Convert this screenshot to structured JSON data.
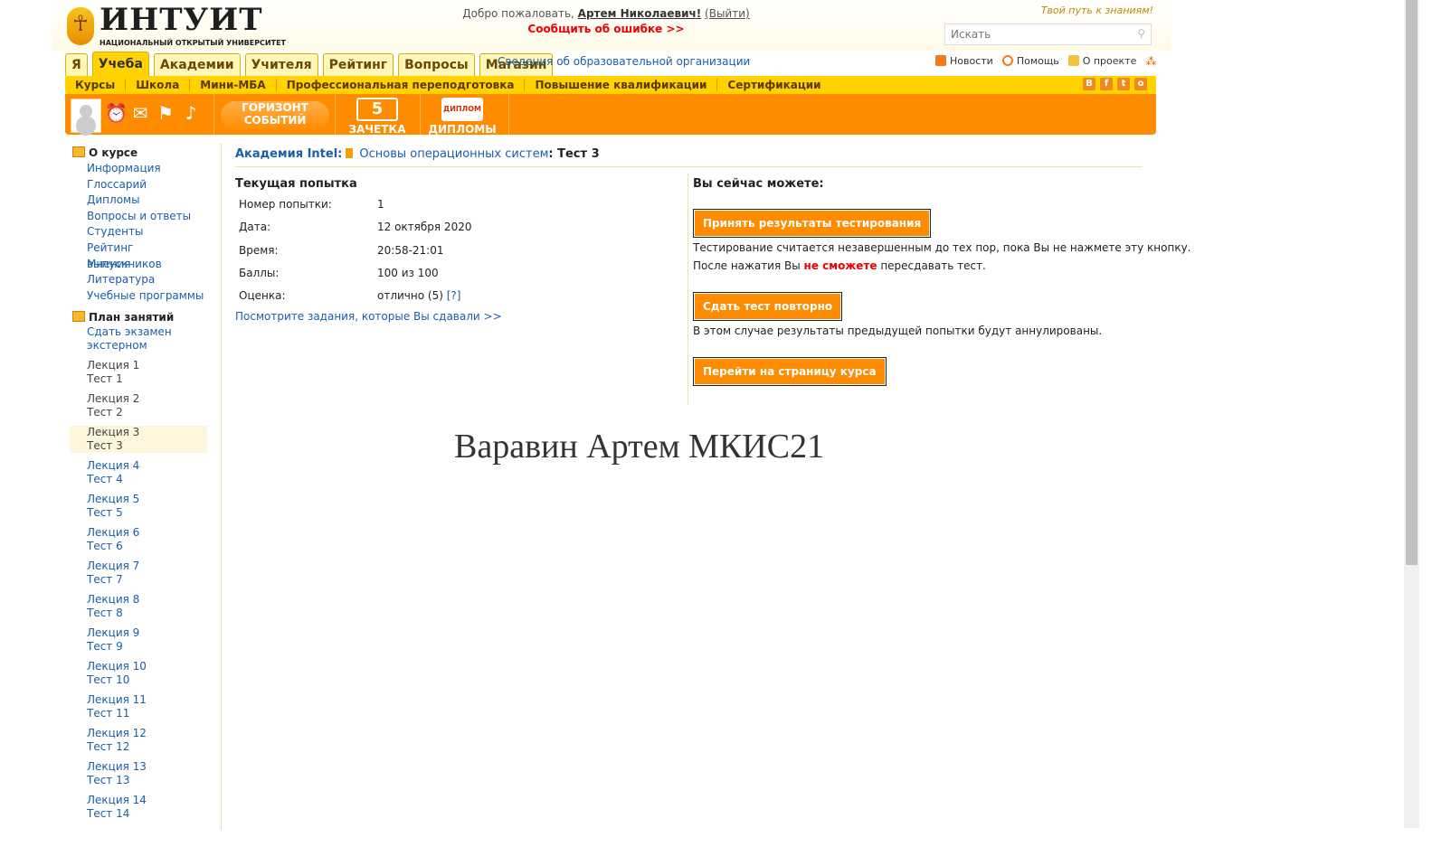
{
  "header": {
    "logo_name": "ИНТУИТ",
    "logo_sub": "НАЦИОНАЛЬНЫЙ ОТКРЫТЫЙ УНИВЕРСИТЕТ",
    "welcome_prefix": "Добро пожаловать,",
    "user_name": "Артем Николаевич",
    "logout": "(Выйти)",
    "report_error": "Сообщить об ошибке >>",
    "slogan": "Твой путь к знаниям!",
    "search_placeholder": "Искать"
  },
  "tabs": [
    "Я",
    "Учеба",
    "Академии",
    "Учителя",
    "Рейтинг",
    "Вопросы",
    "Магазин"
  ],
  "active_tab": "Учеба",
  "org_info": "Сведения об образовательной организации",
  "top_links": {
    "news": "Новости",
    "help": "Помощь",
    "about": "О проекте"
  },
  "sub_menu": [
    "Курсы",
    "Школа",
    "Мини-МБА",
    "Профессиональная переподготовка",
    "Повышение квалификации",
    "Сертификации"
  ],
  "social": [
    "В",
    "f",
    "t",
    "о"
  ],
  "orange_bar": {
    "horizon_line1": "ГОРИЗОНТ",
    "horizon_line2": "СОБЫТИЙ",
    "record_book_num": "5",
    "record_book": "ЗАЧЕТКА",
    "diplomas_icon": "ДИПЛОМ",
    "diplomas": "ДИПЛОМЫ"
  },
  "sidebar": {
    "about_title": "О курсе",
    "about_items": [
      "Информация",
      "Глоссарий",
      "Дипломы",
      "Вопросы и ответы",
      "Студенты",
      "Рейтинг выпускников",
      "Мнения",
      "Литература",
      "Учебные программы"
    ],
    "plan_title": "План занятий",
    "exam_line1": "Сдать экзамен",
    "exam_line2": "экстерном",
    "lessons": [
      {
        "lecture": "Лекция 1",
        "test": "Тест 1"
      },
      {
        "lecture": "Лекция 2",
        "test": "Тест 2"
      },
      {
        "lecture": "Лекция 3",
        "test": "Тест 3"
      },
      {
        "lecture": "Лекция 4",
        "test": "Тест 4"
      },
      {
        "lecture": "Лекция 5",
        "test": "Тест 5"
      },
      {
        "lecture": "Лекция 6",
        "test": "Тест 6"
      },
      {
        "lecture": "Лекция 7",
        "test": "Тест 7"
      },
      {
        "lecture": "Лекция 8",
        "test": "Тест 8"
      },
      {
        "lecture": "Лекция 9",
        "test": "Тест 9"
      },
      {
        "lecture": "Лекция 10",
        "test": "Тест 10"
      },
      {
        "lecture": "Лекция 11",
        "test": "Тест 11"
      },
      {
        "lecture": "Лекция 12",
        "test": "Тест 12"
      },
      {
        "lecture": "Лекция 13",
        "test": "Тест 13"
      },
      {
        "lecture": "Лекция 14",
        "test": "Тест 14"
      }
    ]
  },
  "breadcrumb": {
    "academy": "Академия Intel:",
    "course": "Основы операционных систем",
    "current": ": Тест 3"
  },
  "attempt": {
    "title": "Текущая попытка",
    "rows": [
      {
        "label": "Номер попытки:",
        "value": "1"
      },
      {
        "label": "Дата:",
        "value": "12 октября 2020"
      },
      {
        "label": "Время:",
        "value": "20:58-21:01"
      },
      {
        "label": "Баллы:",
        "value": "100 из 100"
      },
      {
        "label": "Оценка:",
        "value": "отлично (5)",
        "hint": "[?]"
      }
    ],
    "see_tasks": "Посмотрите задания, которые Вы сдавали >>"
  },
  "actions": {
    "title": "Вы сейчас можете:",
    "accept_button": "Принять результаты тестирования",
    "accept_note_line1": "Тестирование считается незавершенным до тех пор, пока Вы не нажмете эту кнопку.",
    "accept_note_prefix": "После нажатия Вы ",
    "accept_note_red": "не сможете",
    "accept_note_suffix": " пересдавать тест.",
    "retry_button": "Сдать тест повторно",
    "retry_note": "В этом случае результаты предыдущей попытки будут аннулированы.",
    "course_button": "Перейти на страницу курса"
  },
  "signature": "Варавин Артем МКИС21",
  "colors": {
    "orange": "#ff8c00",
    "yellow": "#ffd200",
    "link": "#1a5ea8",
    "alert": "#e00000"
  }
}
